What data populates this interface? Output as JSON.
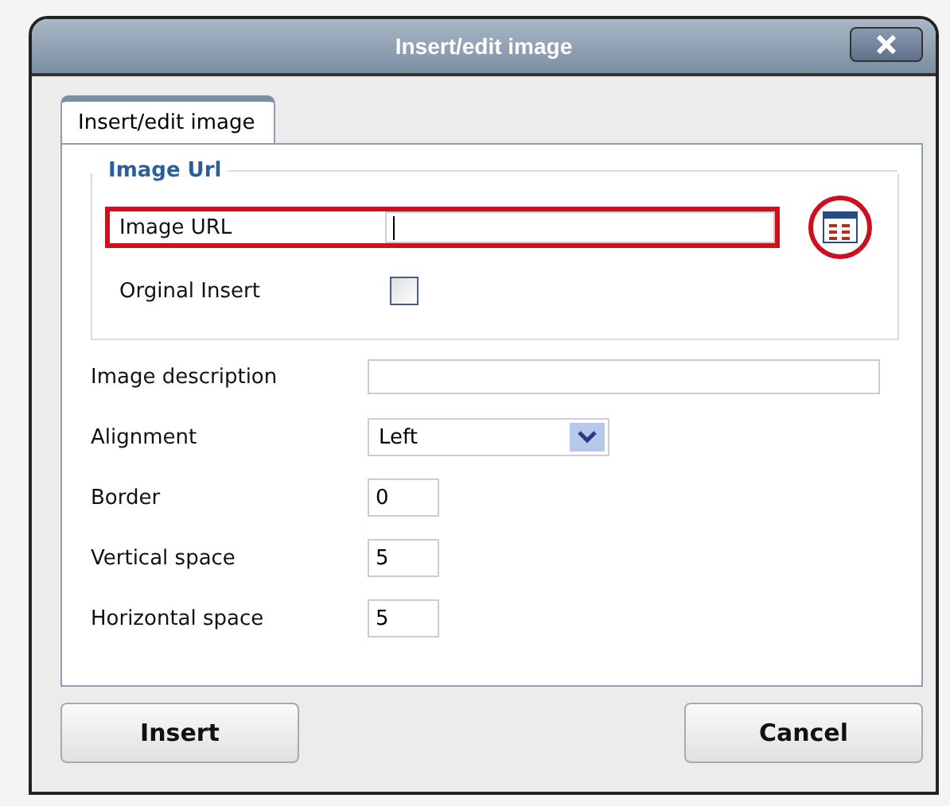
{
  "window": {
    "title": "Insert/edit image"
  },
  "tabs": [
    {
      "label": "Insert/edit image",
      "selected": true
    }
  ],
  "url_group": {
    "legend": "Image Url",
    "fields": [
      {
        "kind": "text",
        "label": "Image URL",
        "focused": true,
        "highlighted": true,
        "browse": true
      },
      {
        "kind": "checkbox",
        "label": "Orginal Insert",
        "checked": false
      }
    ]
  },
  "fields": [
    {
      "kind": "wide",
      "label": "Image description"
    },
    {
      "kind": "select",
      "label": "Alignment",
      "value": "Left"
    },
    {
      "kind": "small",
      "label": "Border",
      "value": "0"
    },
    {
      "kind": "small",
      "label": "Vertical space",
      "value": "5"
    },
    {
      "kind": "small",
      "label": "Horizontal space",
      "value": "5"
    }
  ],
  "buttons": [
    {
      "label": "Insert"
    },
    {
      "label": "Cancel"
    }
  ]
}
